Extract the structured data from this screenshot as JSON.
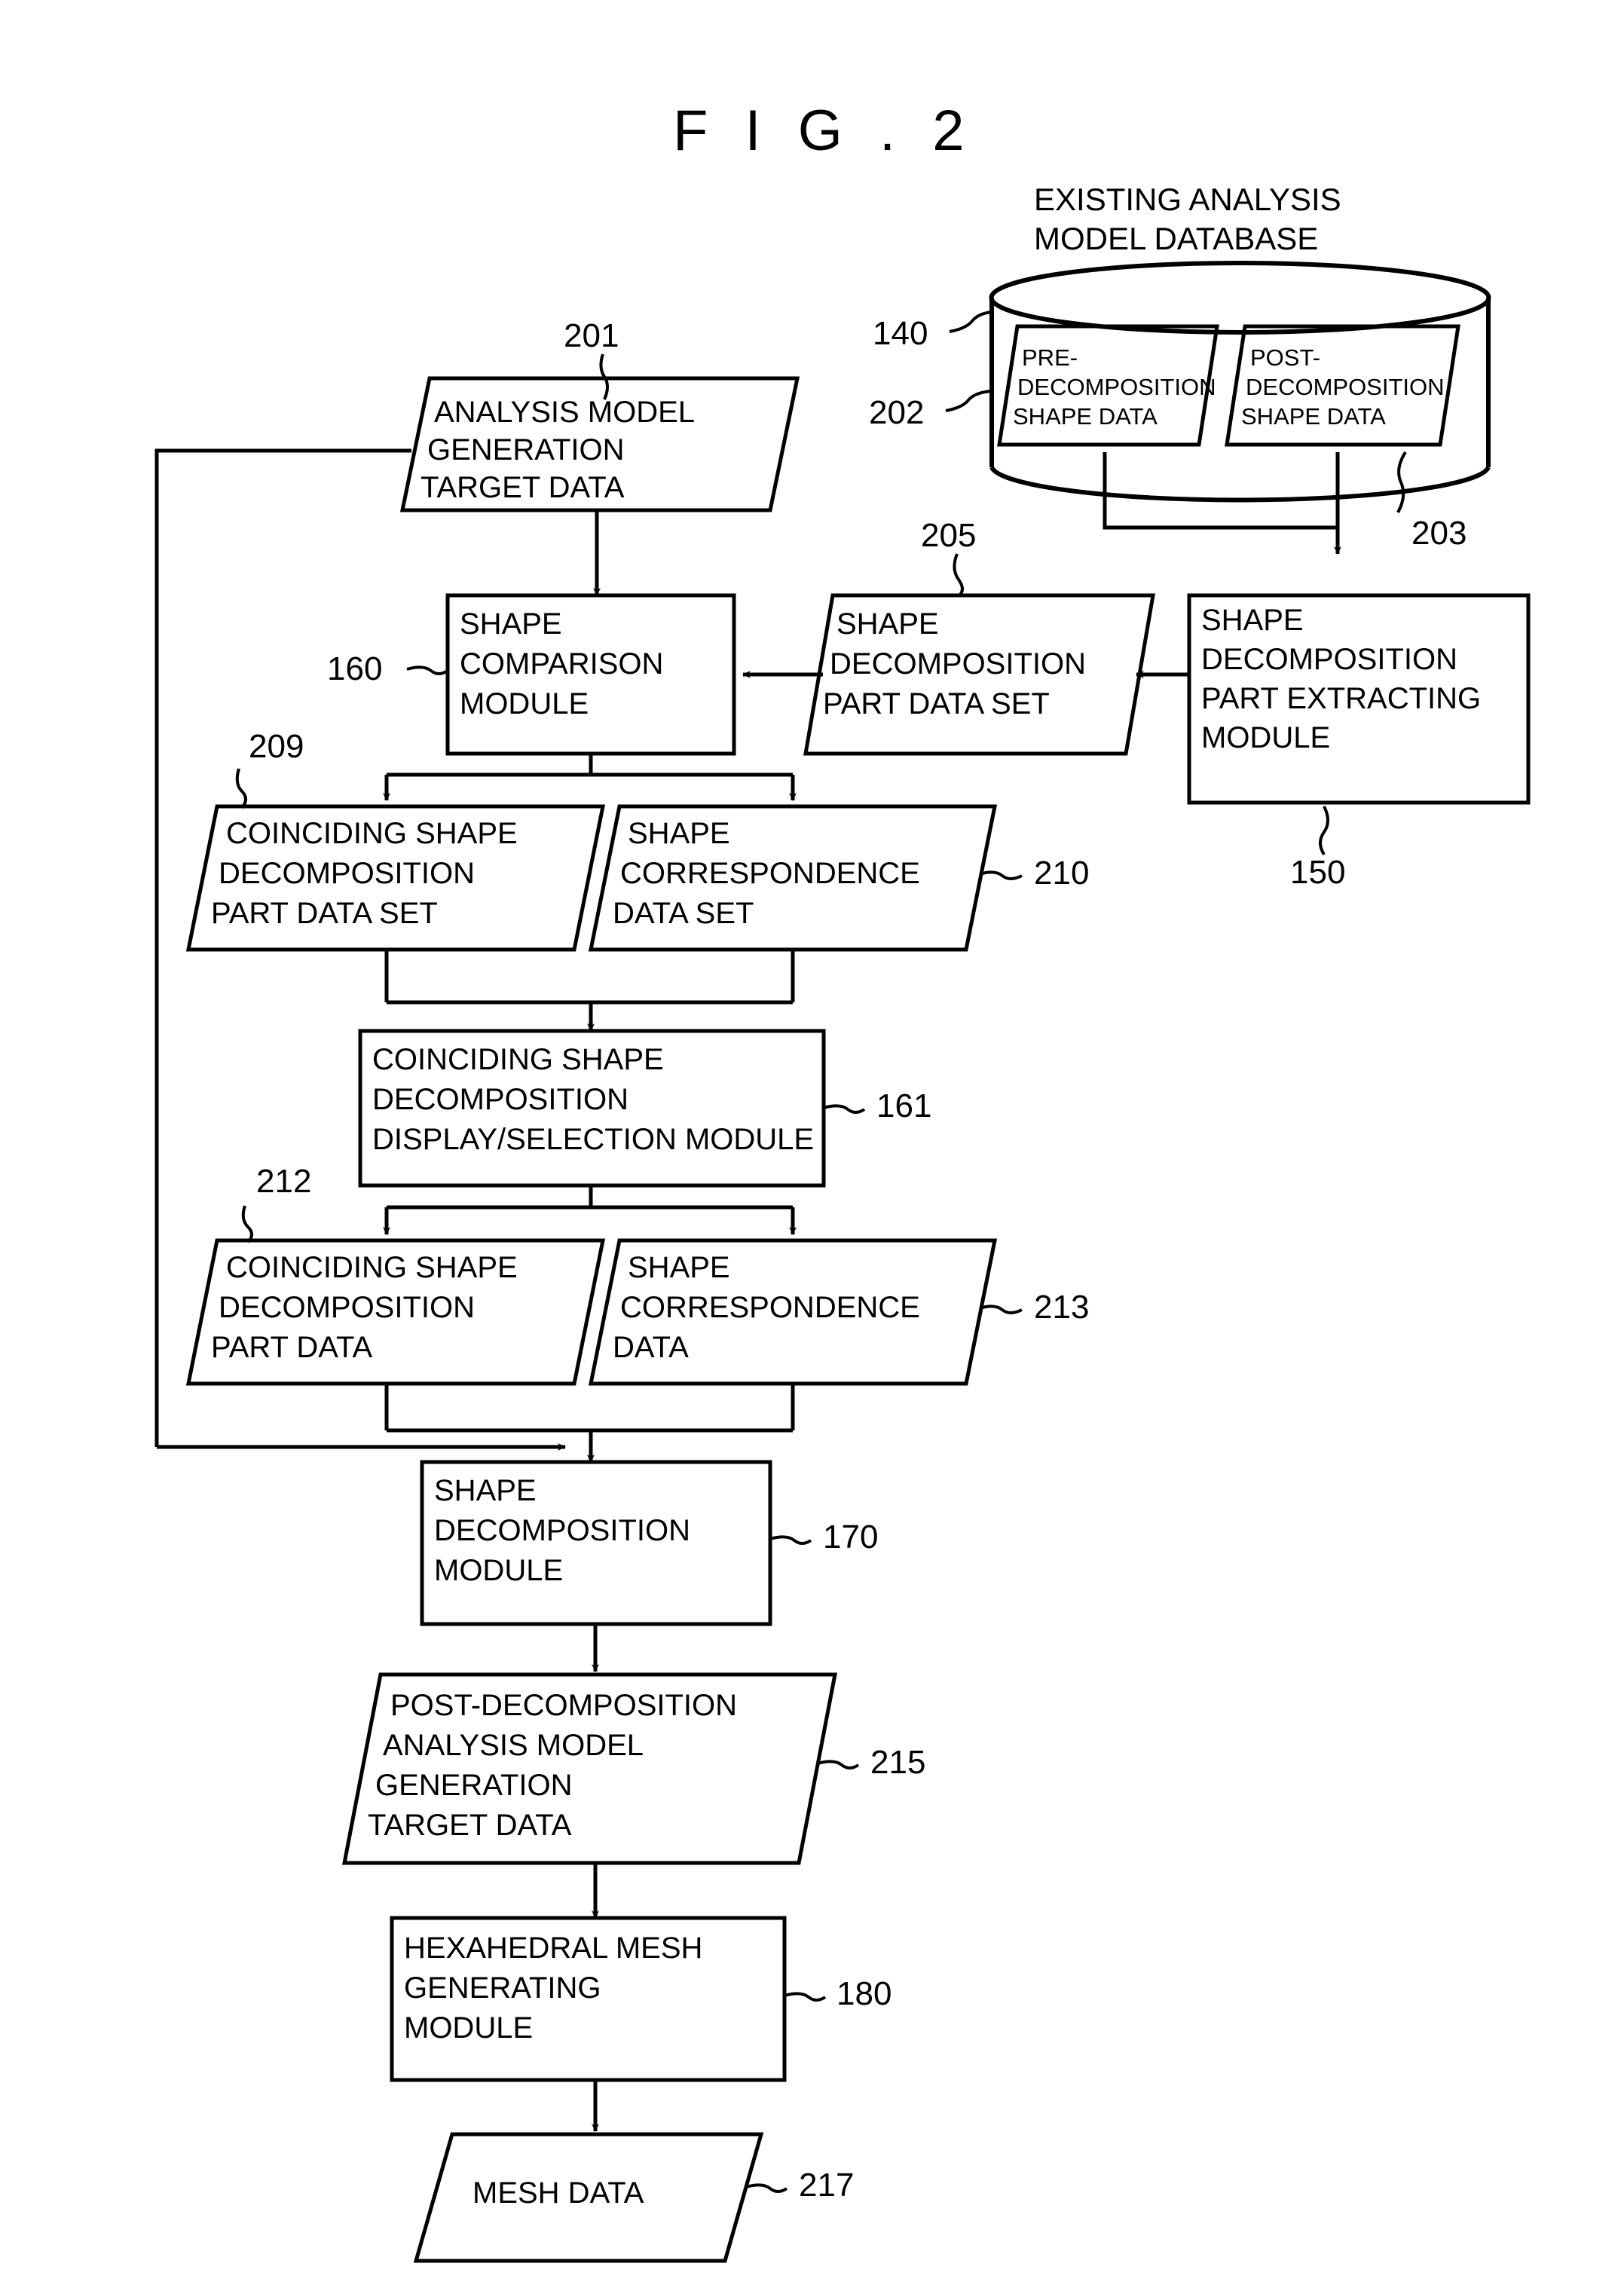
{
  "figure": {
    "title": "F I G . 2"
  },
  "database": {
    "caption_line1": "EXISTING ANALYSIS",
    "caption_line2": "MODEL DATABASE",
    "ref_db": "140",
    "ref_pre": "202",
    "ref_post": "203",
    "pre_shape_data": {
      "line1": "PRE-",
      "line2": "DECOMPOSITION",
      "line3": "SHAPE DATA"
    },
    "post_shape_data": {
      "line1": "POST-",
      "line2": "DECOMPOSITION",
      "line3": "SHAPE DATA"
    }
  },
  "nodes": {
    "n201": {
      "ref": "201",
      "line1": "ANALYSIS MODEL",
      "line2": "GENERATION",
      "line3": "TARGET DATA"
    },
    "n160": {
      "ref": "160",
      "line1": "SHAPE",
      "line2": "COMPARISON",
      "line3": "MODULE"
    },
    "n205": {
      "ref": "205",
      "line1": "SHAPE",
      "line2": "DECOMPOSITION",
      "line3": "PART DATA SET"
    },
    "n150": {
      "ref": "150",
      "line1": "SHAPE",
      "line2": "DECOMPOSITION",
      "line3": "PART EXTRACTING",
      "line4": "MODULE"
    },
    "n209": {
      "ref": "209",
      "line1": "COINCIDING SHAPE",
      "line2": "DECOMPOSITION",
      "line3": "PART DATA SET"
    },
    "n210": {
      "ref": "210",
      "line1": "SHAPE",
      "line2": "CORRESPONDENCE",
      "line3": "DATA SET"
    },
    "n161": {
      "ref": "161",
      "line1": "COINCIDING SHAPE",
      "line2": "DECOMPOSITION",
      "line3": "DISPLAY/SELECTION MODULE"
    },
    "n212": {
      "ref": "212",
      "line1": "COINCIDING SHAPE",
      "line2": "DECOMPOSITION",
      "line3": "PART DATA"
    },
    "n213": {
      "ref": "213",
      "line1": "SHAPE",
      "line2": "CORRESPONDENCE",
      "line3": "DATA"
    },
    "n170": {
      "ref": "170",
      "line1": "SHAPE",
      "line2": "DECOMPOSITION",
      "line3": "MODULE"
    },
    "n215": {
      "ref": "215",
      "line1": "POST-DECOMPOSITION",
      "line2": "ANALYSIS MODEL",
      "line3": "GENERATION",
      "line4": "TARGET DATA"
    },
    "n180": {
      "ref": "180",
      "line1": "HEXAHEDRAL MESH",
      "line2": "GENERATING",
      "line3": "MODULE"
    },
    "n217": {
      "ref": "217",
      "line1": "MESH DATA"
    }
  },
  "colors": {
    "stroke": "#000000",
    "background": "#ffffff"
  }
}
